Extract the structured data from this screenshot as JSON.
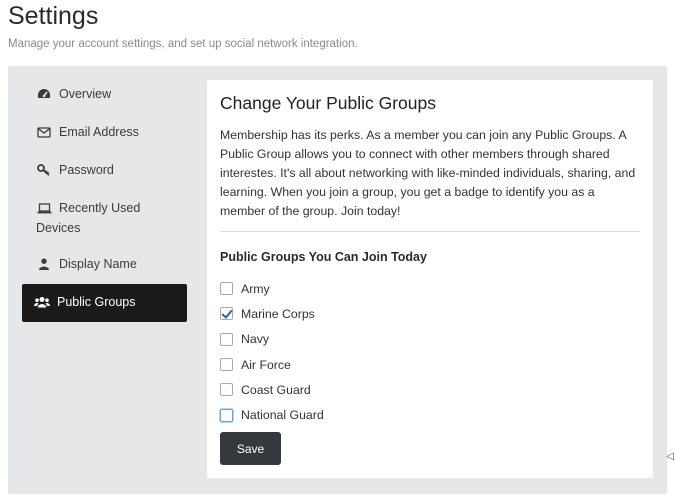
{
  "header": {
    "title": "Settings",
    "subtitle": "Manage your account settings, and set up social network integration."
  },
  "sidebar": {
    "items": [
      {
        "label": "Overview",
        "icon": "dashboard-icon",
        "active": false
      },
      {
        "label": "Email Address",
        "icon": "envelope-icon",
        "active": false
      },
      {
        "label": "Password",
        "icon": "key-icon",
        "active": false
      },
      {
        "label": "Recently Used Devices",
        "icon": "laptop-icon",
        "active": false
      },
      {
        "label": "Display Name",
        "icon": "user-icon",
        "active": false
      },
      {
        "label": "Public Groups",
        "icon": "users-icon",
        "active": true
      }
    ]
  },
  "main": {
    "title": "Change Your Public Groups",
    "description": "Membership has its perks. As a member you can join any Public Groups. A Public Group allows you to connect with other members through shared interestes. It's all about networking with like-minded individuals, sharing, and learning. When you join a group, you get a badge to identify you as a member of the group. Join today!",
    "groups_heading": "Public Groups You Can Join Today",
    "groups": [
      {
        "label": "Army",
        "checked": false
      },
      {
        "label": "Marine Corps",
        "checked": true
      },
      {
        "label": "Navy",
        "checked": false
      },
      {
        "label": "Air Force",
        "checked": false
      },
      {
        "label": "Coast Guard",
        "checked": false
      },
      {
        "label": "National Guard",
        "checked": false,
        "focused": true
      }
    ],
    "save_label": "Save"
  },
  "colors": {
    "panel_background": "#e6e7e9",
    "active_item_background": "#1b1b1b",
    "save_button_background": "#35383d",
    "checkmark": "#2b5fa8"
  }
}
